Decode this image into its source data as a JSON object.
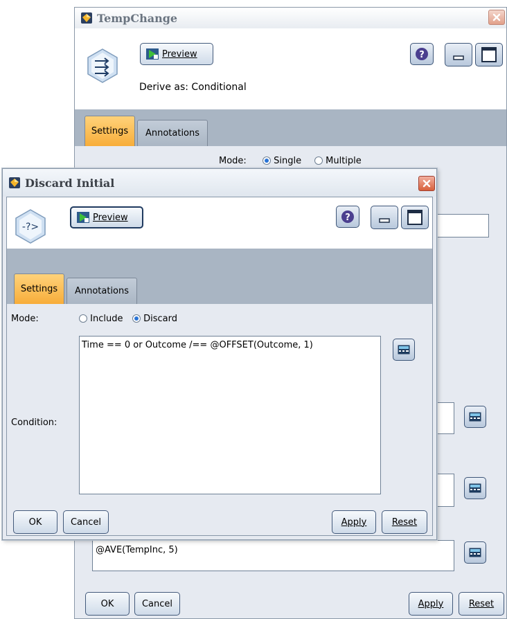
{
  "back_window": {
    "title": "TempChange",
    "toolbar": {
      "preview_label": "Preview"
    },
    "node_description": "Derive as: Conditional",
    "tabs": [
      "Settings",
      "Annotations"
    ],
    "mode": {
      "label": "Mode:",
      "options": [
        "Single",
        "Multiple"
      ],
      "selected": "Single"
    },
    "expression_text": "@AVE(TempInc, 5)",
    "buttons": {
      "ok": "OK",
      "cancel": "Cancel",
      "apply": "Apply",
      "reset": "Reset"
    }
  },
  "front_window": {
    "title": "Discard Initial",
    "toolbar": {
      "preview_label": "Preview"
    },
    "tabs": [
      "Settings",
      "Annotations"
    ],
    "mode": {
      "label": "Mode:",
      "options": [
        "Include",
        "Discard"
      ],
      "selected": "Discard"
    },
    "condition": {
      "label": "Condition:",
      "value": "Time == 0 or Outcome /== @OFFSET(Outcome, 1)"
    },
    "buttons": {
      "ok": "OK",
      "cancel": "Cancel",
      "apply": "Apply",
      "reset": "Reset"
    }
  },
  "icons": {
    "app": "node-diamond-icon",
    "derive_node": "derive-node-icon",
    "select_node": "select-node-icon",
    "preview": "preview-play-icon",
    "help": "help-icon",
    "minimize": "minimize-icon",
    "maximize": "maximize-icon",
    "close": "close-icon",
    "expression_builder": "calculator-icon"
  },
  "colors": {
    "active_tab": "#f7ad3a",
    "tab_band": "#a9b5c3",
    "panel": "#e6eaf1",
    "close": "#d8603c",
    "radio_selected": "#2a74d6"
  }
}
